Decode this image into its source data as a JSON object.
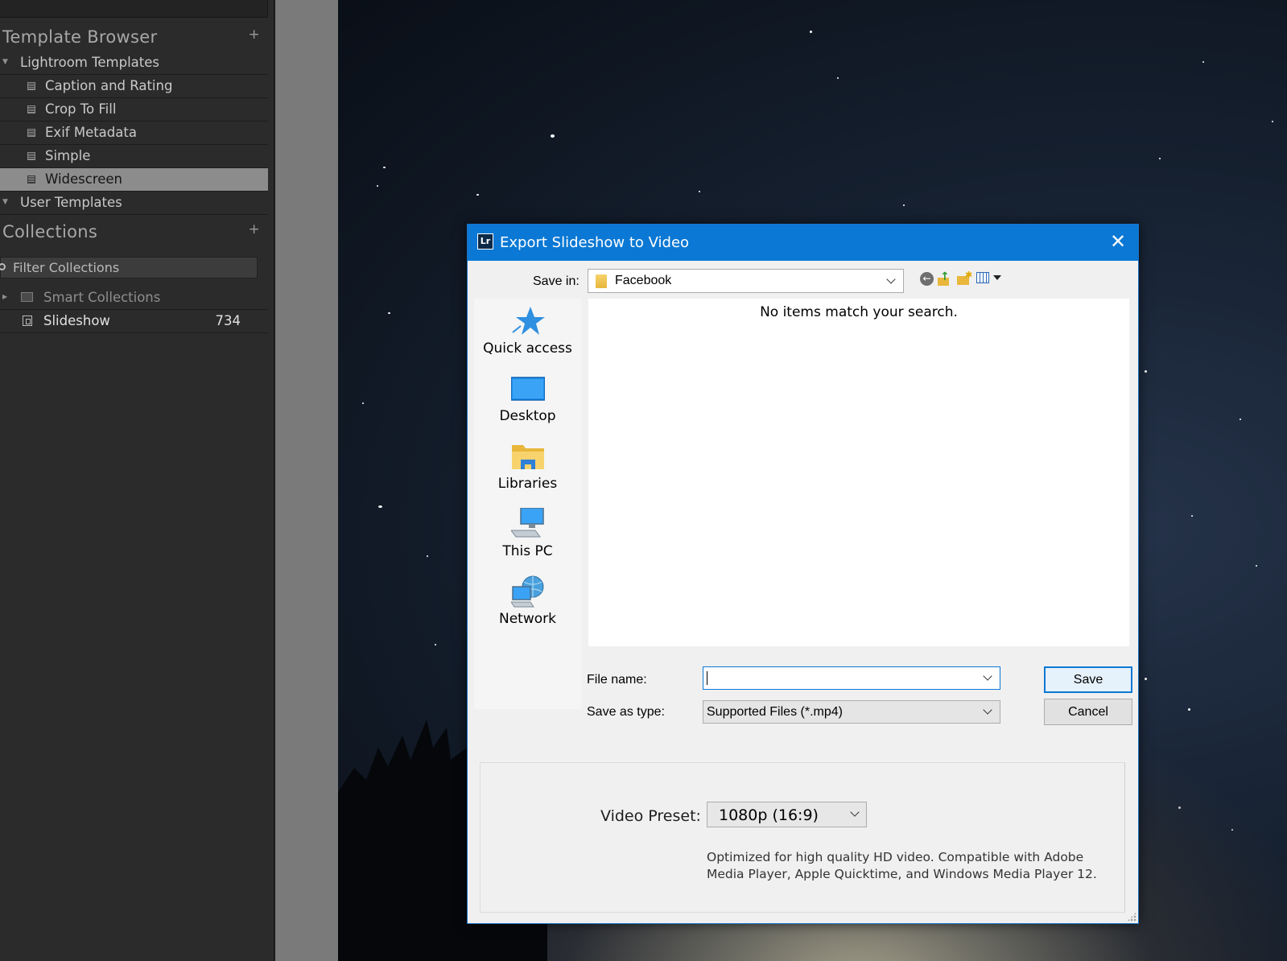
{
  "left_panel": {
    "template_browser": {
      "title": "Template Browser",
      "add_label": "+",
      "groups": [
        {
          "label": "Lightroom Templates"
        },
        {
          "label": "User Templates"
        }
      ],
      "items": [
        {
          "label": "Caption and Rating"
        },
        {
          "label": "Crop To Fill"
        },
        {
          "label": "Exif Metadata"
        },
        {
          "label": "Simple"
        },
        {
          "label": "Widescreen",
          "selected": true
        }
      ]
    },
    "collections": {
      "title": "Collections",
      "add_label": "+",
      "filter_placeholder": "Filter Collections",
      "smart_collections_label": "Smart Collections",
      "slideshow_label": "Slideshow",
      "slideshow_count": "734"
    }
  },
  "dialog": {
    "title": "Export Slideshow to Video",
    "app_icon_text": "Lr",
    "close_glyph": "✕",
    "save_in_label": "Save in:",
    "save_in_value": "Facebook",
    "places": [
      {
        "label": "Quick access",
        "icon": "quick-access-star-icon"
      },
      {
        "label": "Desktop",
        "icon": "desktop-icon"
      },
      {
        "label": "Libraries",
        "icon": "libraries-icon"
      },
      {
        "label": "This PC",
        "icon": "this-pc-icon"
      },
      {
        "label": "Network",
        "icon": "network-icon"
      }
    ],
    "empty_message": "No items match your search.",
    "file_name_label": "File name:",
    "file_name_value": "",
    "save_as_type_label": "Save as type:",
    "save_as_type_value": "Supported Files (*.mp4)",
    "save_button": "Save",
    "cancel_button": "Cancel",
    "video_preset_label": "Video Preset:",
    "video_preset_value": "1080p (16:9)",
    "video_preset_description": "Optimized for high quality HD video. Compatible with Adobe Media Player, Apple Quicktime, and Windows Media Player 12."
  },
  "colors": {
    "titlebar": "#0a78d4",
    "lr_panel": "#2b2b2b",
    "selected_row": "#8c8c8c"
  }
}
